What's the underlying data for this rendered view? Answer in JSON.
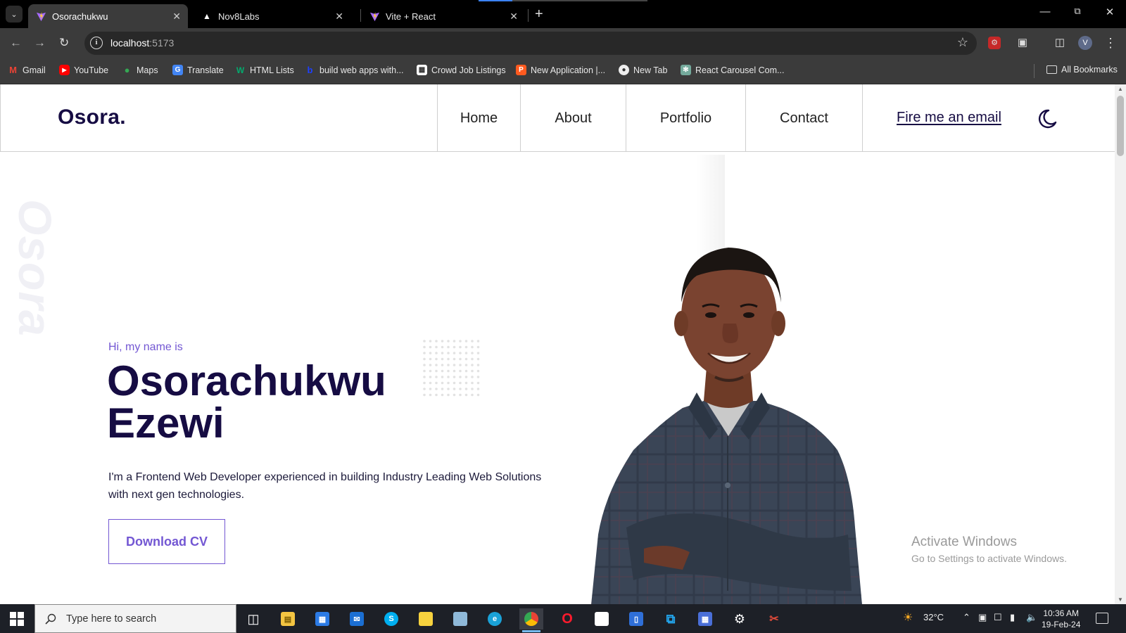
{
  "browser": {
    "tabs": [
      {
        "title": "Osorachukwu",
        "active": true
      },
      {
        "title": "Nov8Labs",
        "active": false
      },
      {
        "title": "Vite + React",
        "active": false
      }
    ],
    "url_host": "localhost",
    "url_port": ":5173",
    "avatar_letter": "V",
    "bookmarks": [
      {
        "label": "Gmail",
        "icon": "gmail-icon"
      },
      {
        "label": "YouTube",
        "icon": "youtube-icon"
      },
      {
        "label": "Maps",
        "icon": "maps-icon"
      },
      {
        "label": "Translate",
        "icon": "translate-icon"
      },
      {
        "label": "HTML Lists",
        "icon": "w3schools-icon"
      },
      {
        "label": "build web apps with...",
        "icon": "bubble-icon"
      },
      {
        "label": "Crowd Job Listings",
        "icon": "crowd-icon"
      },
      {
        "label": "New Application |...",
        "icon": "application-icon"
      },
      {
        "label": "New Tab",
        "icon": "globe-icon"
      },
      {
        "label": "React Carousel Com...",
        "icon": "openai-icon"
      }
    ],
    "all_bookmarks_label": "All Bookmarks"
  },
  "site": {
    "logo": "Osora.",
    "nav": [
      "Home",
      "About",
      "Portfolio",
      "Contact"
    ],
    "email_link": "Fire me an email",
    "theme_toggle_icon": "moon-icon",
    "watermark": "Osora",
    "hero": {
      "greeting": "Hi, my name is",
      "name_line1": "Osorachukwu",
      "name_line2": "Ezewi",
      "description": "I'm a Frontend Web Developer experienced in building Industry Leading Web Solutions with next gen technologies.",
      "cta": "Download CV"
    },
    "colors": {
      "brand_dark": "#160c43",
      "accent": "#7357d3"
    }
  },
  "overlay": {
    "activate_title": "Activate Windows",
    "activate_subtitle": "Go to Settings to activate Windows."
  },
  "taskbar": {
    "search_placeholder": "Type here to search",
    "weather": "32°C",
    "time": "10:36 AM",
    "date": "19-Feb-24"
  }
}
